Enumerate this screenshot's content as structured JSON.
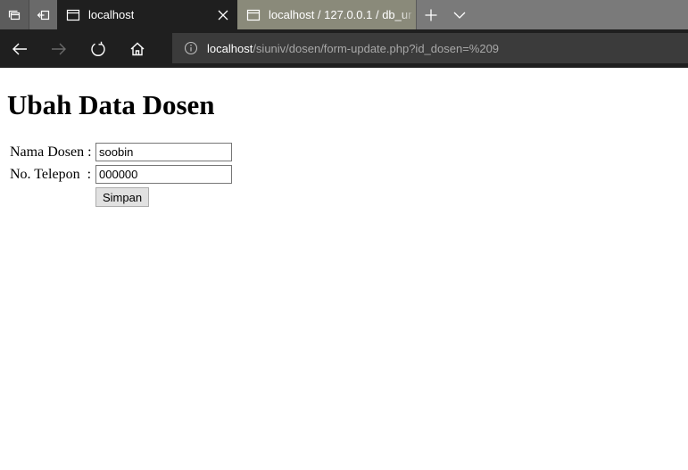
{
  "browser": {
    "tabs": [
      {
        "title": "localhost",
        "active": true
      },
      {
        "title": "localhost / 127.0.0.1 / db_ur",
        "active": false
      }
    ],
    "address": {
      "host": "localhost",
      "path": "/siuniv/dosen/form-update.php?id_dosen=%209"
    }
  },
  "form": {
    "title": "Ubah Data Dosen",
    "fields": [
      {
        "label": "Nama Dosen :",
        "value": "soobin"
      },
      {
        "label": "No. Telepon  :",
        "value": "000000"
      }
    ],
    "submit_label": "Simpan"
  },
  "colors": {
    "chrome_dark": "#1f1f1f",
    "tabstrip": "#7a7a7a",
    "address_bg": "#3b3b3b"
  }
}
